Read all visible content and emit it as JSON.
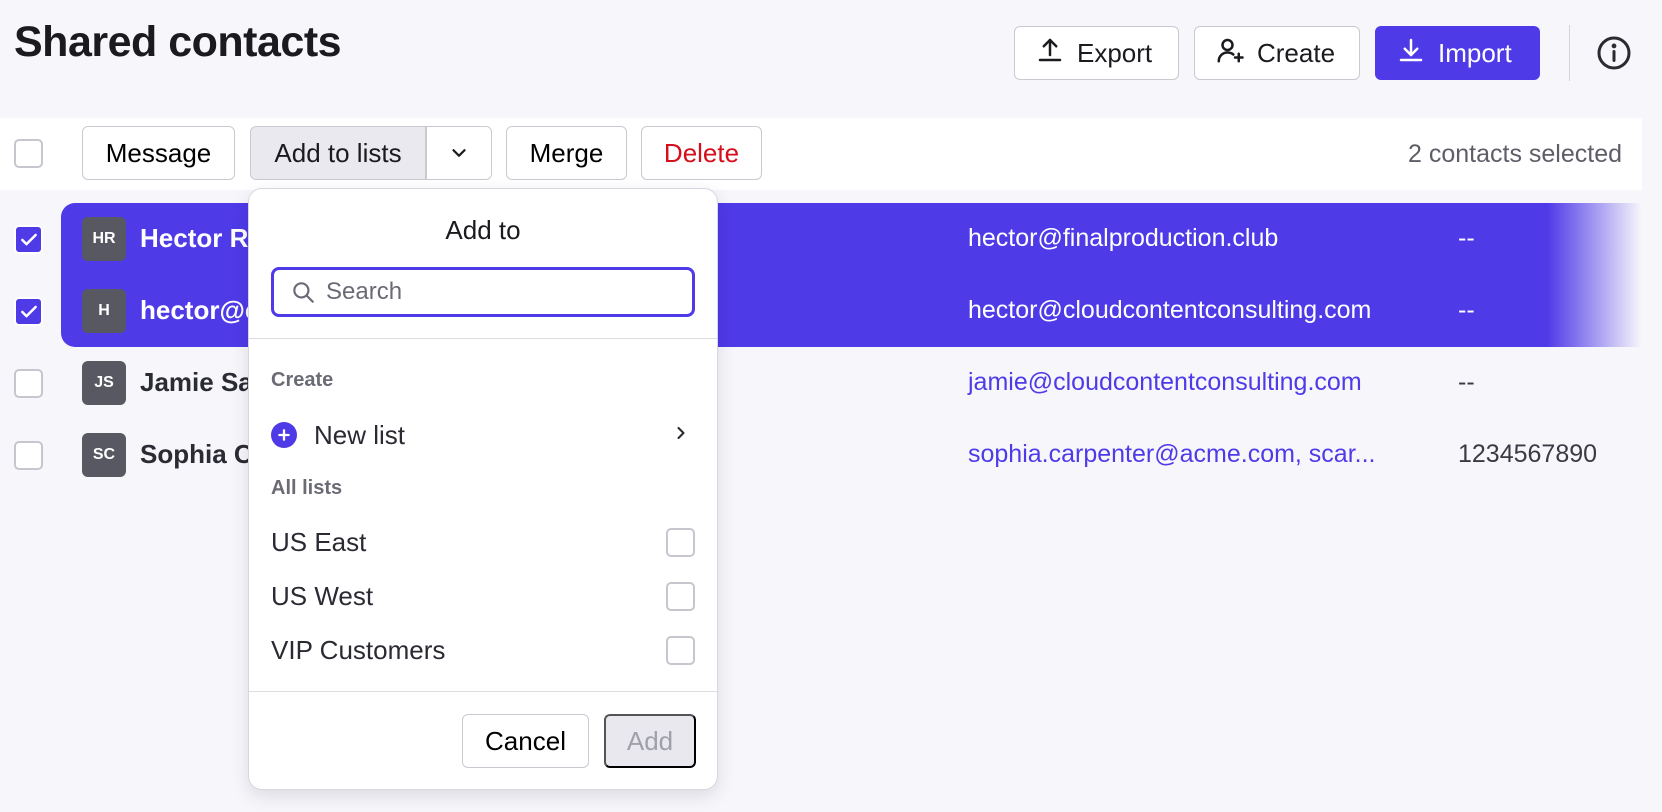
{
  "page": {
    "title": "Shared contacts"
  },
  "header": {
    "export_label": "Export",
    "create_label": "Create",
    "import_label": "Import",
    "info_icon": "info-icon"
  },
  "toolbar": {
    "message_label": "Message",
    "add_to_lists_label": "Add to lists",
    "merge_label": "Merge",
    "delete_label": "Delete",
    "selected_count": "2 contacts selected"
  },
  "contacts": [
    {
      "initials": "HR",
      "name": "Hector Rc",
      "email": "hector@finalproduction.club",
      "phone": "--",
      "selected": true
    },
    {
      "initials": "H",
      "name": "hector@c",
      "email": "hector@cloudcontentconsulting.com",
      "phone": "--",
      "selected": true
    },
    {
      "initials": "JS",
      "name": "Jamie Sa",
      "email": "jamie@cloudcontentconsulting.com",
      "phone": "--",
      "selected": false
    },
    {
      "initials": "SC",
      "name": "Sophia C",
      "email": "sophia.carpenter@acme.com, scar...",
      "phone": "1234567890",
      "selected": false
    }
  ],
  "dropdown": {
    "title": "Add to",
    "search_placeholder": "Search",
    "create_section": "Create",
    "new_list_label": "New list",
    "all_lists_section": "All lists",
    "lists": [
      {
        "label": "US East",
        "checked": false
      },
      {
        "label": "US West",
        "checked": false
      },
      {
        "label": "VIP Customers",
        "checked": false
      }
    ],
    "cancel_label": "Cancel",
    "add_label": "Add"
  },
  "colors": {
    "accent": "#4f3ae8",
    "danger": "#d50f1c",
    "background": "#f7f7fb"
  }
}
